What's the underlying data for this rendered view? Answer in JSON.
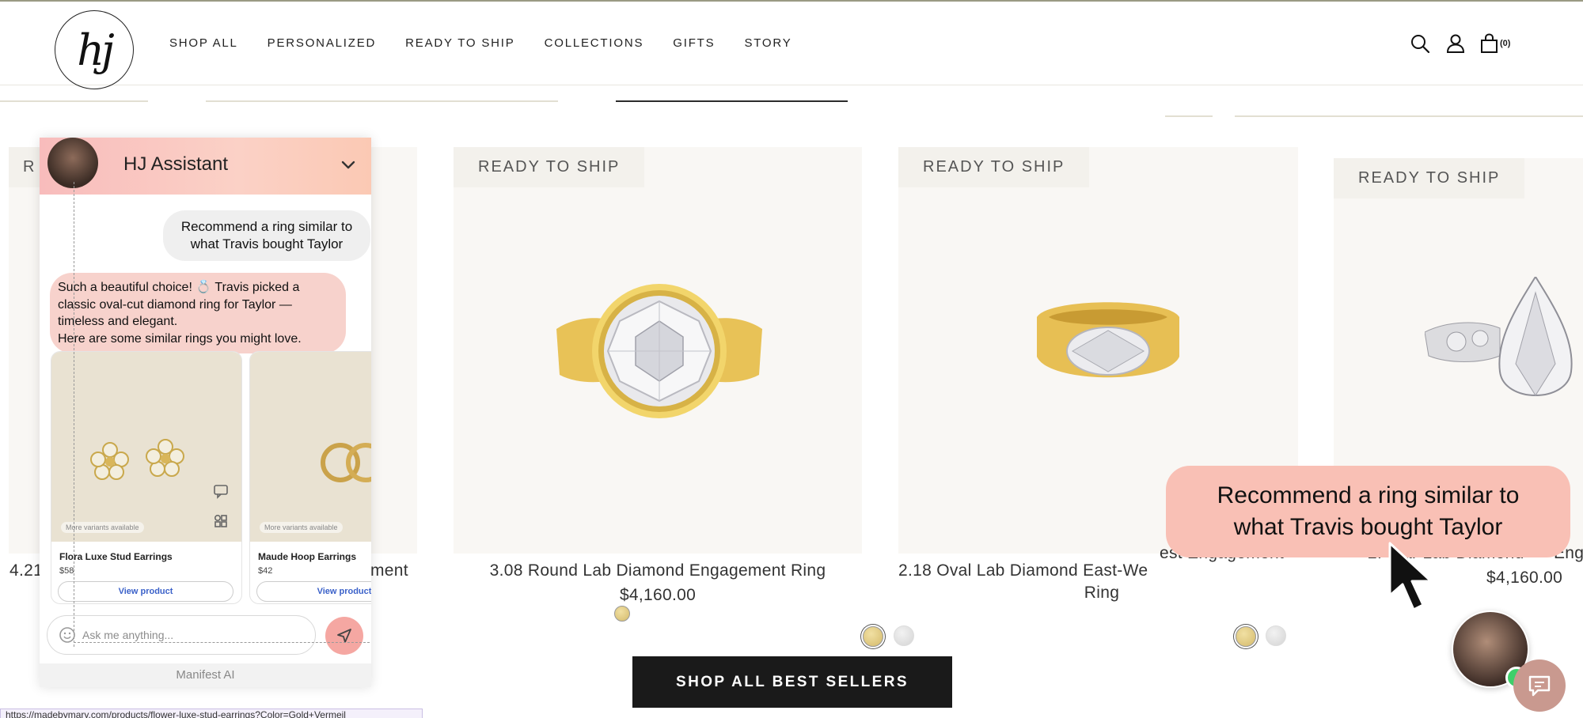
{
  "brand": {
    "logo_text": "hj"
  },
  "nav": {
    "items": [
      "SHOP ALL",
      "PERSONALIZED",
      "READY TO SHIP",
      "COLLECTIONS",
      "GIFTS",
      "STORY"
    ]
  },
  "header_icons": {
    "search": "search-icon",
    "account": "user-icon",
    "cart": "bag-icon",
    "cart_count": "(0)"
  },
  "products": [
    {
      "title_partial": "4.21",
      "title_tail": "ement",
      "badge": "R"
    },
    {
      "badge": "READY TO SHIP",
      "title": "3.08 Round Lab Diamond Engagement Ring",
      "price": "$4,160.00"
    },
    {
      "badge": "READY TO SHIP",
      "title_line1": "2.18 Oval Lab Diamond East-We",
      "title_line2": "Ring",
      "title_behind": "est Engagement"
    },
    {
      "badge": "READY TO SHIP",
      "title_partial": "Engagement",
      "title_prefix": "2.",
      "title_mid": "ear Lab Diamond",
      "title_end": "Enga",
      "price": "$4,160.00"
    }
  ],
  "cta": {
    "shop_all_best_sellers": "SHOP ALL BEST SELLERS"
  },
  "chat": {
    "title": "HJ Assistant",
    "user_message": "Recommend a ring similar to what Travis bought Taylor",
    "bot_lines": [
      "Such a beautiful choice! 💍 Travis picked a",
      "classic oval-cut diamond ring for Taylor —",
      "timeless and elegant.",
      "Here are some similar rings you might love."
    ],
    "products": [
      {
        "variants": "More variants available",
        "name": "Flora Luxe Stud Earrings",
        "price": "$58",
        "button": "View product"
      },
      {
        "variants": "More variants available",
        "name": "Maude Hoop Earrings",
        "price": "$42",
        "button": "View product"
      }
    ],
    "input_placeholder": "Ask me anything...",
    "footer": "Manifest AI"
  },
  "status_url": "https://madebymary.com/products/flower-luxe-stud-earrings?Color=Gold+Vermeil",
  "prompt_overlay": "Recommend a ring similar to what Travis bought Taylor",
  "colors": {
    "accent_pink": "#f9c0b5",
    "dark_button": "#1a1a1a",
    "card_bg": "#f9f7f4"
  }
}
